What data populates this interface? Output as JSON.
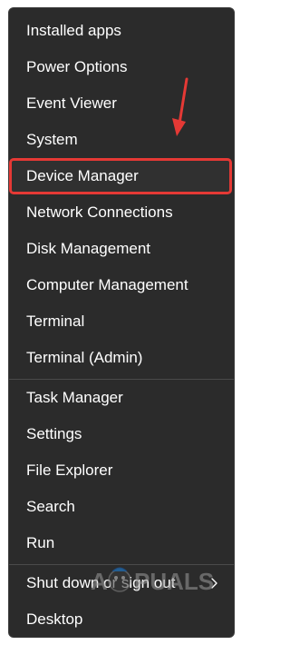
{
  "menu": {
    "items": [
      {
        "label": "Installed apps"
      },
      {
        "label": "Power Options"
      },
      {
        "label": "Event Viewer"
      },
      {
        "label": "System"
      },
      {
        "label": "Device Manager"
      },
      {
        "label": "Network Connections"
      },
      {
        "label": "Disk Management"
      },
      {
        "label": "Computer Management"
      },
      {
        "label": "Terminal"
      },
      {
        "label": "Terminal (Admin)"
      },
      {
        "label": "Task Manager"
      },
      {
        "label": "Settings"
      },
      {
        "label": "File Explorer"
      },
      {
        "label": "Search"
      },
      {
        "label": "Run"
      },
      {
        "label": "Shut down or sign out"
      },
      {
        "label": "Desktop"
      }
    ]
  },
  "annotation": {
    "highlight_color": "#e53935",
    "arrow_icon": "red-arrow-down"
  },
  "watermark": {
    "text": "APPUALS"
  },
  "colors": {
    "menu_bg": "#2b2b2b",
    "text": "#ffffff",
    "divider": "#4a4a4a"
  }
}
